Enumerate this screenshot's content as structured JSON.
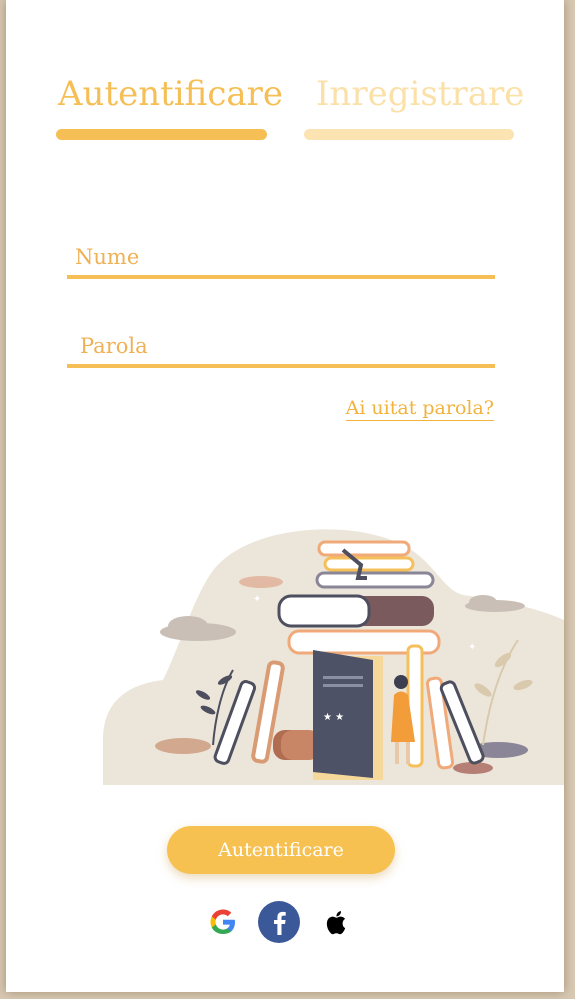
{
  "tabs": {
    "login_label": "Autentificare",
    "register_label": "Inregistrare"
  },
  "form": {
    "name_placeholder": "Nume",
    "password_placeholder": "Parola",
    "forgot_label": "Ai uitat parola?"
  },
  "submit_label": "Autentificare",
  "social": [
    {
      "icon": "google-icon"
    },
    {
      "icon": "facebook-icon"
    },
    {
      "icon": "apple-icon"
    }
  ],
  "colors": {
    "accent": "#f6bf55",
    "accent_light": "#fbe3b2",
    "facebook": "#3b5998"
  }
}
